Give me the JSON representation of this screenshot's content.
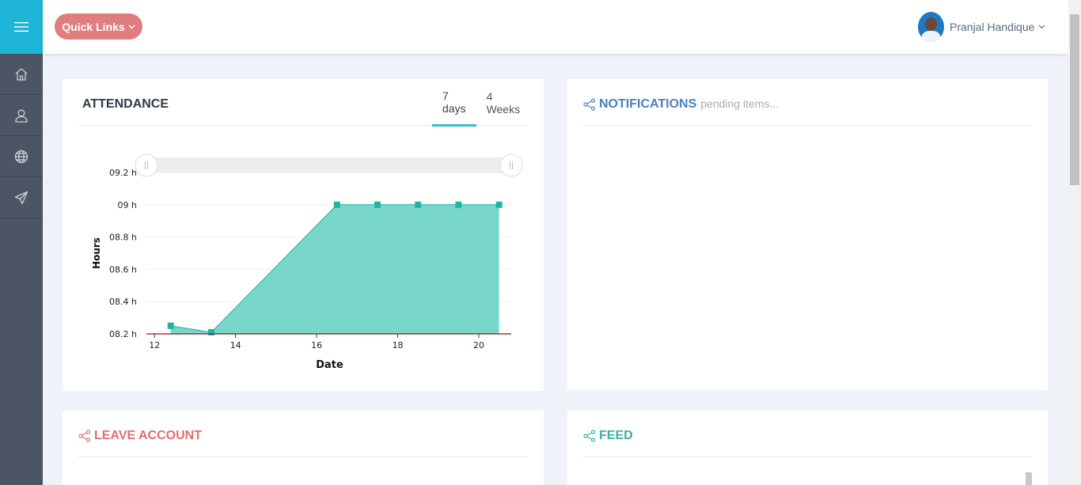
{
  "header": {
    "quick_links_label": "Quick Links",
    "user_name": "Pranjal Handique"
  },
  "sidebar": {
    "items": [
      {
        "icon": "home-icon"
      },
      {
        "icon": "user-icon"
      },
      {
        "icon": "globe-icon"
      },
      {
        "icon": "send-icon"
      }
    ]
  },
  "colors": {
    "sidebar_bg": "#4b5563",
    "sidebar_toggle_bg": "#1fb5d6",
    "quick_links_bg": "#e07d7d",
    "area_fill": "#6dd3c5",
    "area_marker": "#1fb5a0",
    "notifications_title": "#4a7fc1",
    "leave_title": "#e07070",
    "feed_title": "#3bb1a2",
    "tab_active": "#37bcc7"
  },
  "attendance": {
    "title": "ATTENDANCE",
    "tabs": [
      {
        "label": "7 days",
        "active": true
      },
      {
        "label": "4 Weeks",
        "active": false
      }
    ]
  },
  "notifications": {
    "title": "NOTIFICATIONS",
    "subtitle": "pending items..."
  },
  "leave_account": {
    "title": "LEAVE ACCOUNT"
  },
  "feed": {
    "title": "FEED"
  },
  "chart_data": {
    "type": "area",
    "x": [
      12.4,
      13.4,
      16.5,
      17.5,
      18.5,
      19.5,
      20.5
    ],
    "values": [
      8.25,
      8.21,
      9.0,
      9.0,
      9.0,
      9.0,
      9.0
    ],
    "xlabel": "Date",
    "ylabel": "Hours",
    "xticks": [
      {
        "value": 12,
        "label": "12"
      },
      {
        "value": 14,
        "label": "14"
      },
      {
        "value": 16,
        "label": "16"
      },
      {
        "value": 18,
        "label": "18"
      },
      {
        "value": 20,
        "label": "20"
      }
    ],
    "yticks": [
      {
        "value": 8.2,
        "label": "08.2 h"
      },
      {
        "value": 8.4,
        "label": "08.4 h"
      },
      {
        "value": 8.6,
        "label": "08.6 h"
      },
      {
        "value": 8.8,
        "label": "08.8 h"
      },
      {
        "value": 9.0,
        "label": "09 h"
      },
      {
        "value": 9.2,
        "label": "09.2 h"
      }
    ],
    "xlim": [
      11.8,
      20.8
    ],
    "ylim": [
      8.2,
      9.2
    ],
    "grid": true,
    "zoom_range": [
      0,
      1
    ]
  }
}
